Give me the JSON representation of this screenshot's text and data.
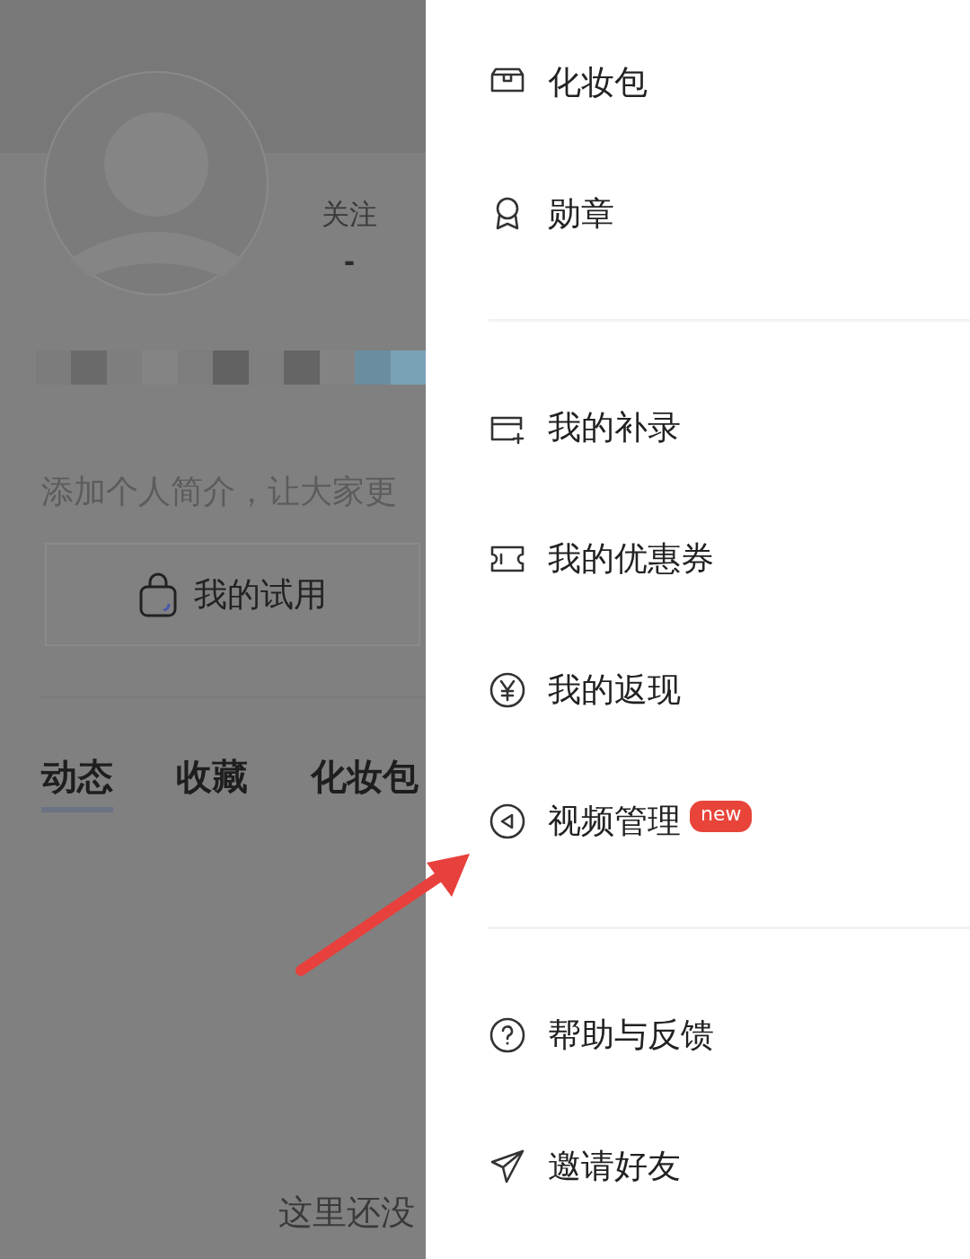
{
  "profile": {
    "follow_label": "关注",
    "follow_count": "-",
    "bio_prompt": "添加个人简介，让大家更",
    "trial_button": "我的试用"
  },
  "tabs": [
    {
      "label": "动态",
      "selected": true
    },
    {
      "label": "收藏",
      "selected": false
    },
    {
      "label": "化妆包",
      "selected": false
    }
  ],
  "empty_text": "这里还没",
  "drawer": {
    "sections": [
      {
        "items": [
          {
            "kind": "bag",
            "label": "化妆包"
          },
          {
            "kind": "medal",
            "label": "勋章"
          }
        ]
      },
      {
        "items": [
          {
            "kind": "supplement",
            "label": "我的补录"
          },
          {
            "kind": "ticket",
            "label": "我的优惠券"
          },
          {
            "kind": "cashback",
            "label": "我的返现"
          },
          {
            "kind": "video",
            "label": "视频管理",
            "badge": "new"
          }
        ]
      },
      {
        "items": [
          {
            "kind": "help",
            "label": "帮助与反馈"
          },
          {
            "kind": "invite",
            "label": "邀请好友"
          }
        ]
      }
    ]
  }
}
